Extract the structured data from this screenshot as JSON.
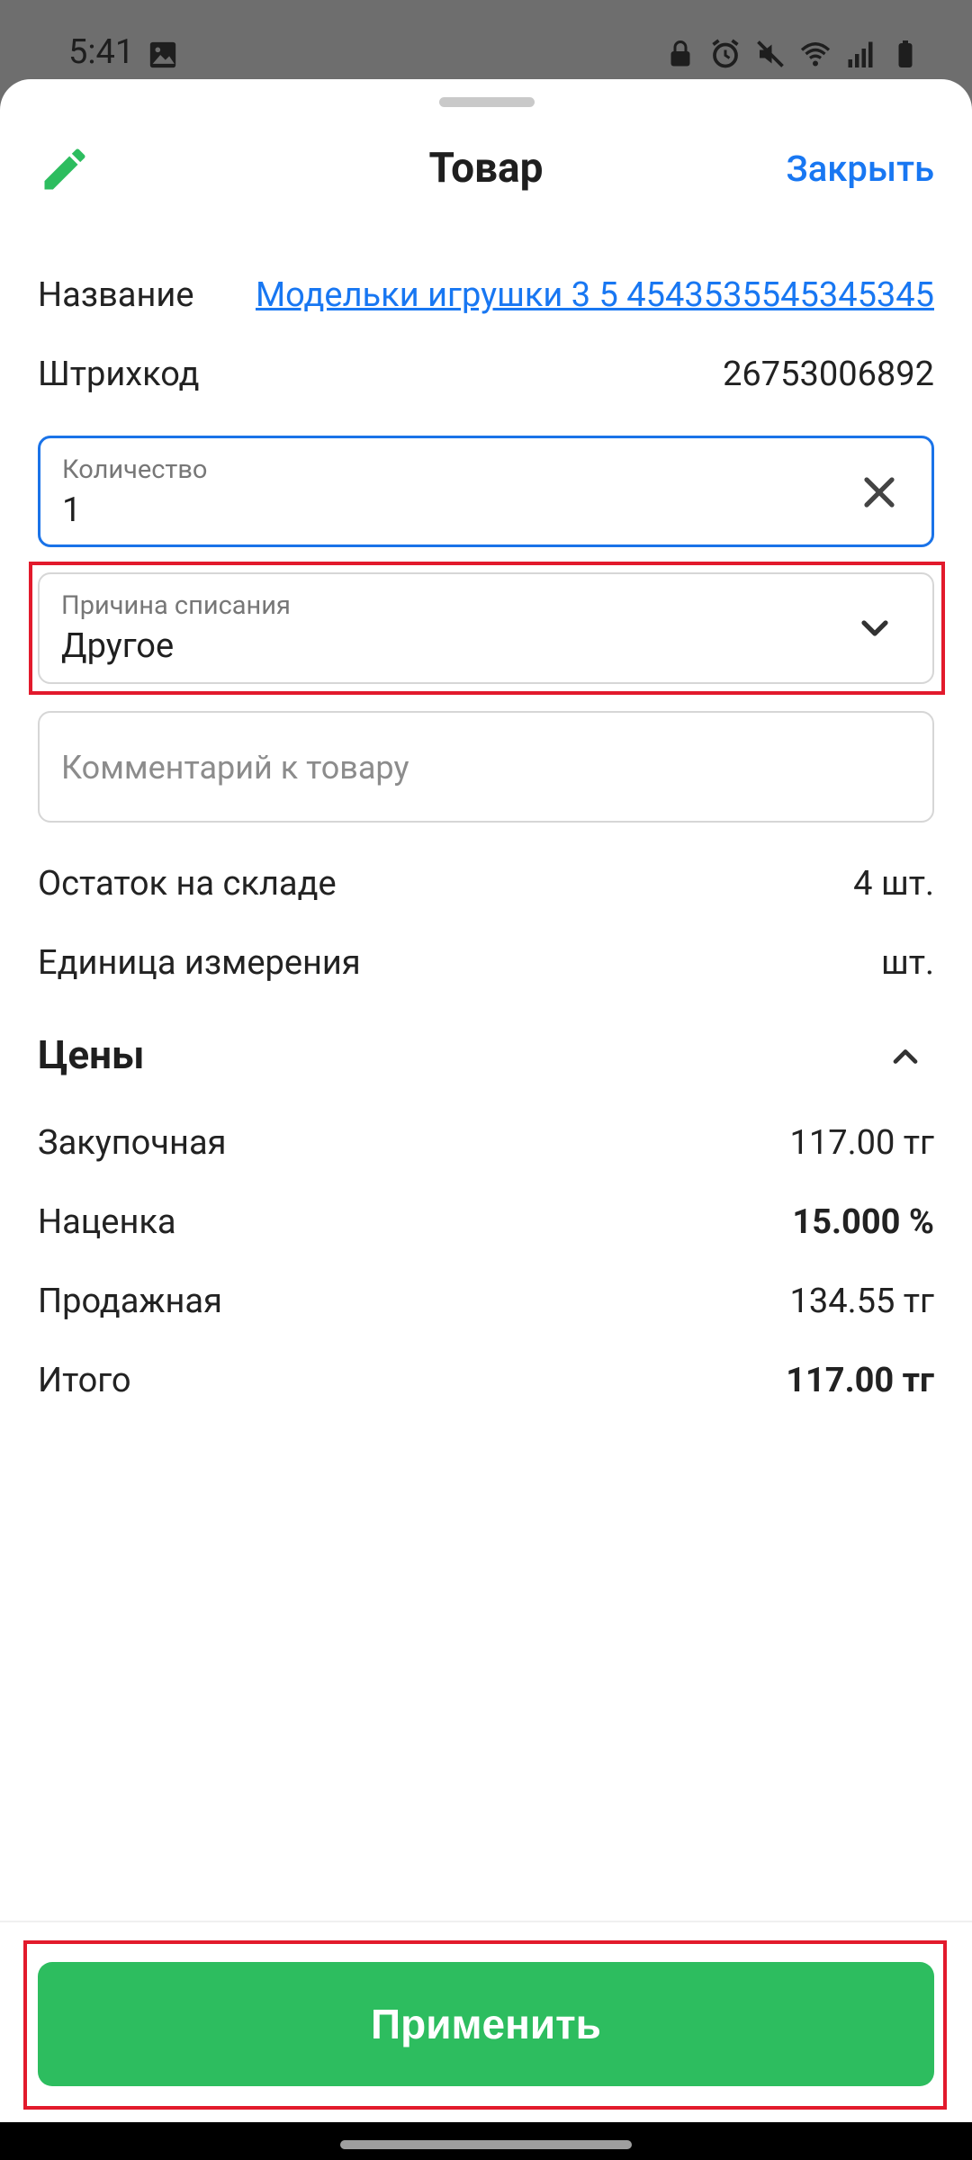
{
  "status_bar": {
    "time": "5:41",
    "left_icons": [
      "image-icon"
    ],
    "right_icons": [
      "lock-icon",
      "alarm-icon",
      "mute-icon",
      "wifi-icon",
      "signal-icon",
      "battery-icon"
    ]
  },
  "header": {
    "title": "Товар",
    "close_label": "Закрыть",
    "edit_icon": "pencil-icon"
  },
  "product": {
    "name_label": "Название",
    "name_value": "Модельки игрушки 3 5 4543535545345345",
    "barcode_label": "Штрихкод",
    "barcode_value": "26753006892"
  },
  "quantity_field": {
    "label": "Количество",
    "value": "1",
    "clear_icon": "close-icon"
  },
  "reason_field": {
    "label": "Причина списания",
    "value": "Другое",
    "dropdown_icon": "chevron-down-icon"
  },
  "comment_field": {
    "placeholder": "Комментарий к товару"
  },
  "stock": {
    "label": "Остаток на складе",
    "value": "4 шт."
  },
  "unit": {
    "label": "Единица измерения",
    "value": "шт."
  },
  "prices": {
    "title": "Цены",
    "collapse_icon": "chevron-up-icon",
    "rows": [
      {
        "label": "Закупочная",
        "value": "117.00 тг",
        "bold": false
      },
      {
        "label": "Наценка",
        "value": "15.000 %",
        "bold": true
      },
      {
        "label": "Продажная",
        "value": "134.55 тг",
        "bold": false
      },
      {
        "label": "Итого",
        "value": "117.00 тг",
        "bold": true
      }
    ]
  },
  "footer": {
    "apply_label": "Применить"
  },
  "colors": {
    "accent_blue": "#1877f2",
    "apply_green": "#2dbd5f",
    "highlight_red": "#e21a2c",
    "edit_green": "#2dbd5f"
  }
}
